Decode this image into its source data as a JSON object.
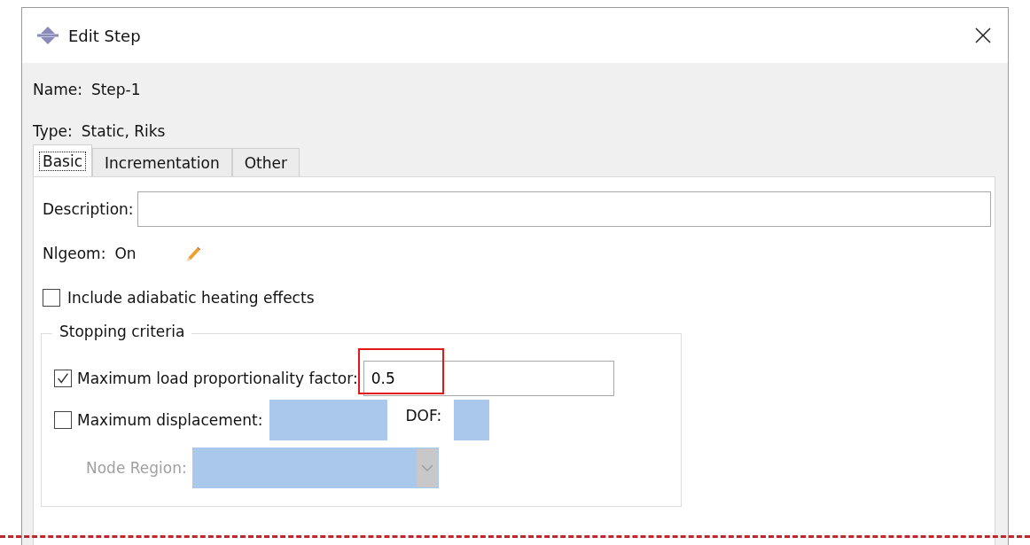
{
  "window": {
    "title": "Edit Step"
  },
  "name": {
    "label": "Name:",
    "value": "Step-1"
  },
  "type": {
    "label": "Type:",
    "value": "Static, Riks"
  },
  "tabs": [
    {
      "label": "Basic",
      "selected": true
    },
    {
      "label": "Incrementation",
      "selected": false
    },
    {
      "label": "Other",
      "selected": false
    }
  ],
  "description": {
    "label": "Description:"
  },
  "nlgeom": {
    "label": "Nlgeom:",
    "value": "On"
  },
  "adiabatic": {
    "label": "Include adiabatic heating effects",
    "checked": false
  },
  "stopping_criteria": {
    "title": "Stopping criteria",
    "max_load": {
      "label": "Maximum load proportionality factor:",
      "checked": true,
      "value": "0.5",
      "highlighted": true
    },
    "max_displacement": {
      "label": "Maximum displacement:",
      "checked": false,
      "dof_label": "DOF:"
    },
    "node_region": {
      "label": "Node Region:",
      "disabled": true
    }
  }
}
